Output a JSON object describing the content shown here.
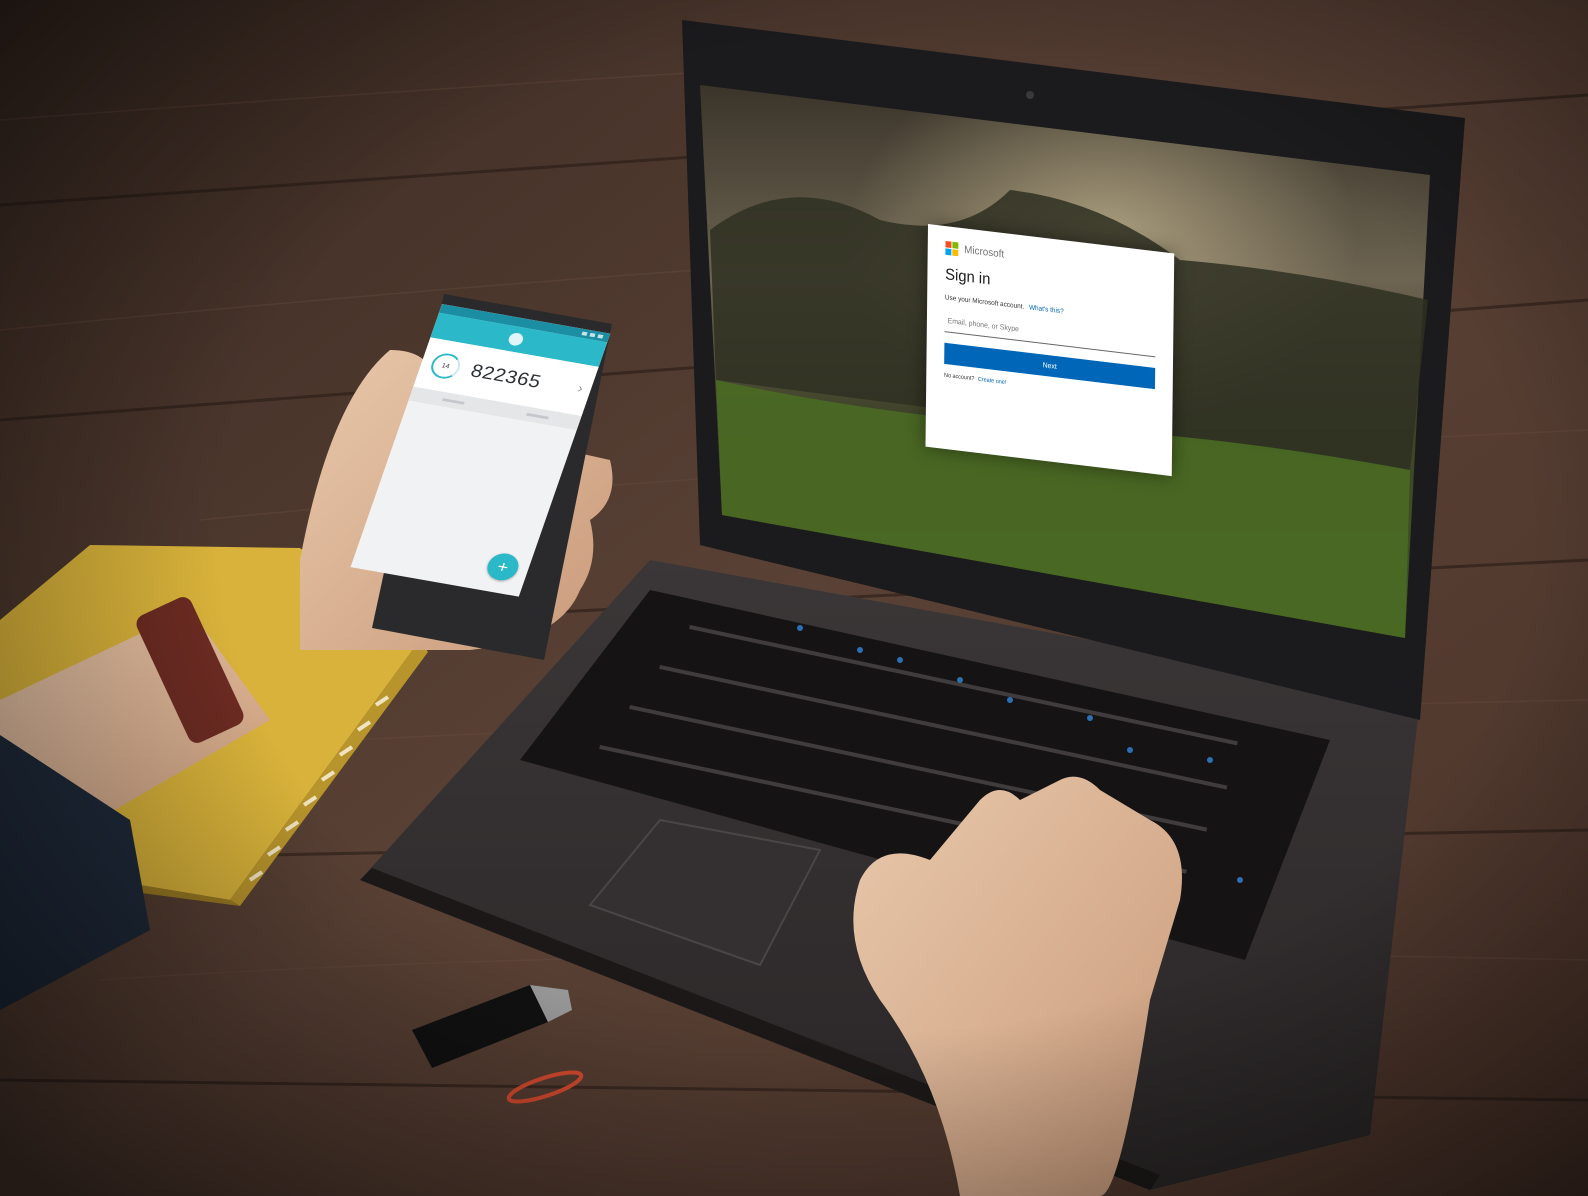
{
  "ms_signin": {
    "brand": "Microsoft",
    "title": "Sign in",
    "subtitle": "Use your Microsoft account.",
    "whats_this": "What's this?",
    "input_placeholder": "Email, phone, or Skype",
    "next_button": "Next",
    "no_account": "No account?",
    "create_one": "Create one!"
  },
  "authenticator": {
    "app_name": "",
    "timer": "14",
    "code": "822365"
  },
  "colors": {
    "ms_blue": "#0067b8",
    "app_teal": "#2bb8c9",
    "ms_logo": [
      "#f25022",
      "#7fba00",
      "#00a4ef",
      "#ffb900"
    ]
  },
  "icons": [
    "microsoft-logo-icon",
    "authenticator-app-icon",
    "timer-icon",
    "chevron-right-icon",
    "add-icon",
    "laptop-camera-icon"
  ]
}
